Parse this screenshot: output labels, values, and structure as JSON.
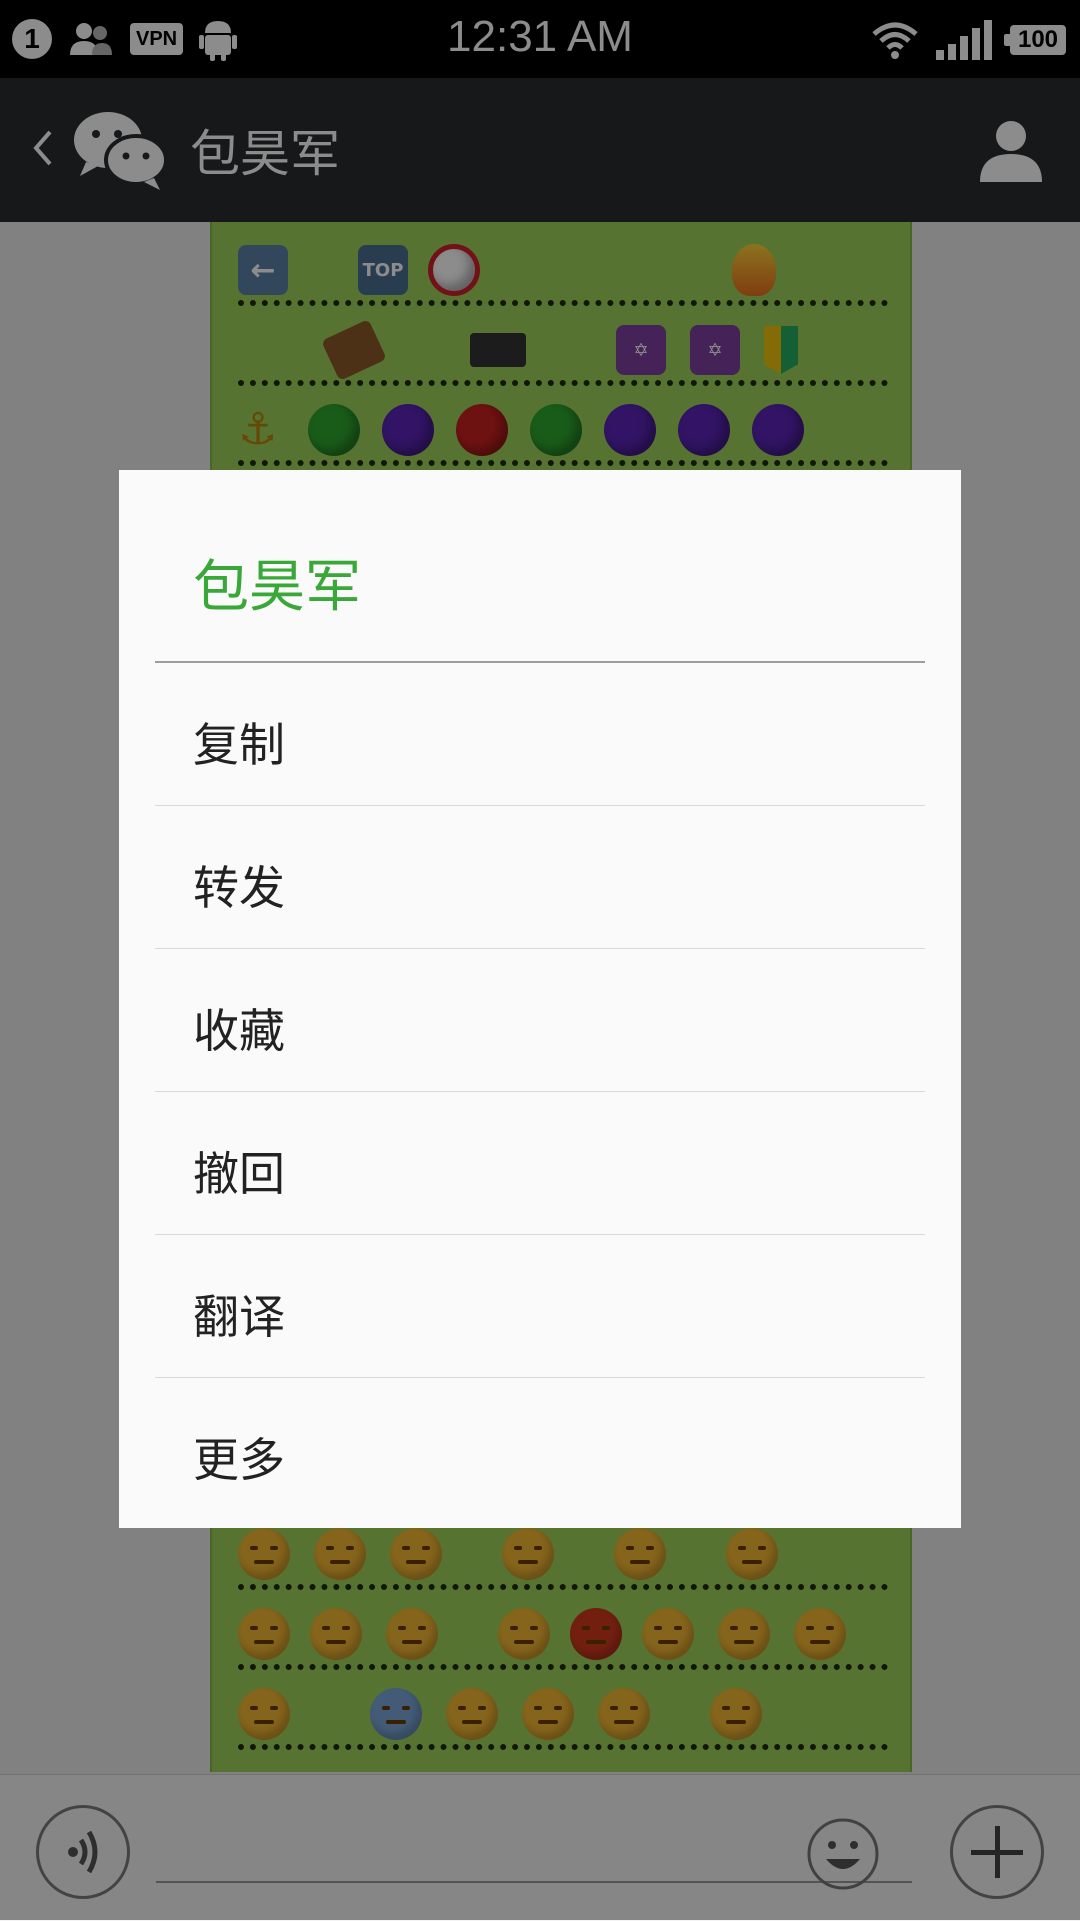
{
  "status_bar": {
    "notification_count": "1",
    "vpn_label": "VPN",
    "time": "12:31 AM",
    "battery": "100"
  },
  "header": {
    "title": "包昊军"
  },
  "chat": {
    "top_row_badge": "TOP"
  },
  "dialog": {
    "title": "包昊军",
    "items": [
      {
        "label": "复制"
      },
      {
        "label": "转发"
      },
      {
        "label": "收藏"
      },
      {
        "label": "撤回"
      },
      {
        "label": "翻译"
      },
      {
        "label": "更多"
      }
    ]
  },
  "colors": {
    "dialog_title": "#3aa838",
    "bubble": "#9ed25b",
    "header_bg": "#2a2c2e"
  }
}
